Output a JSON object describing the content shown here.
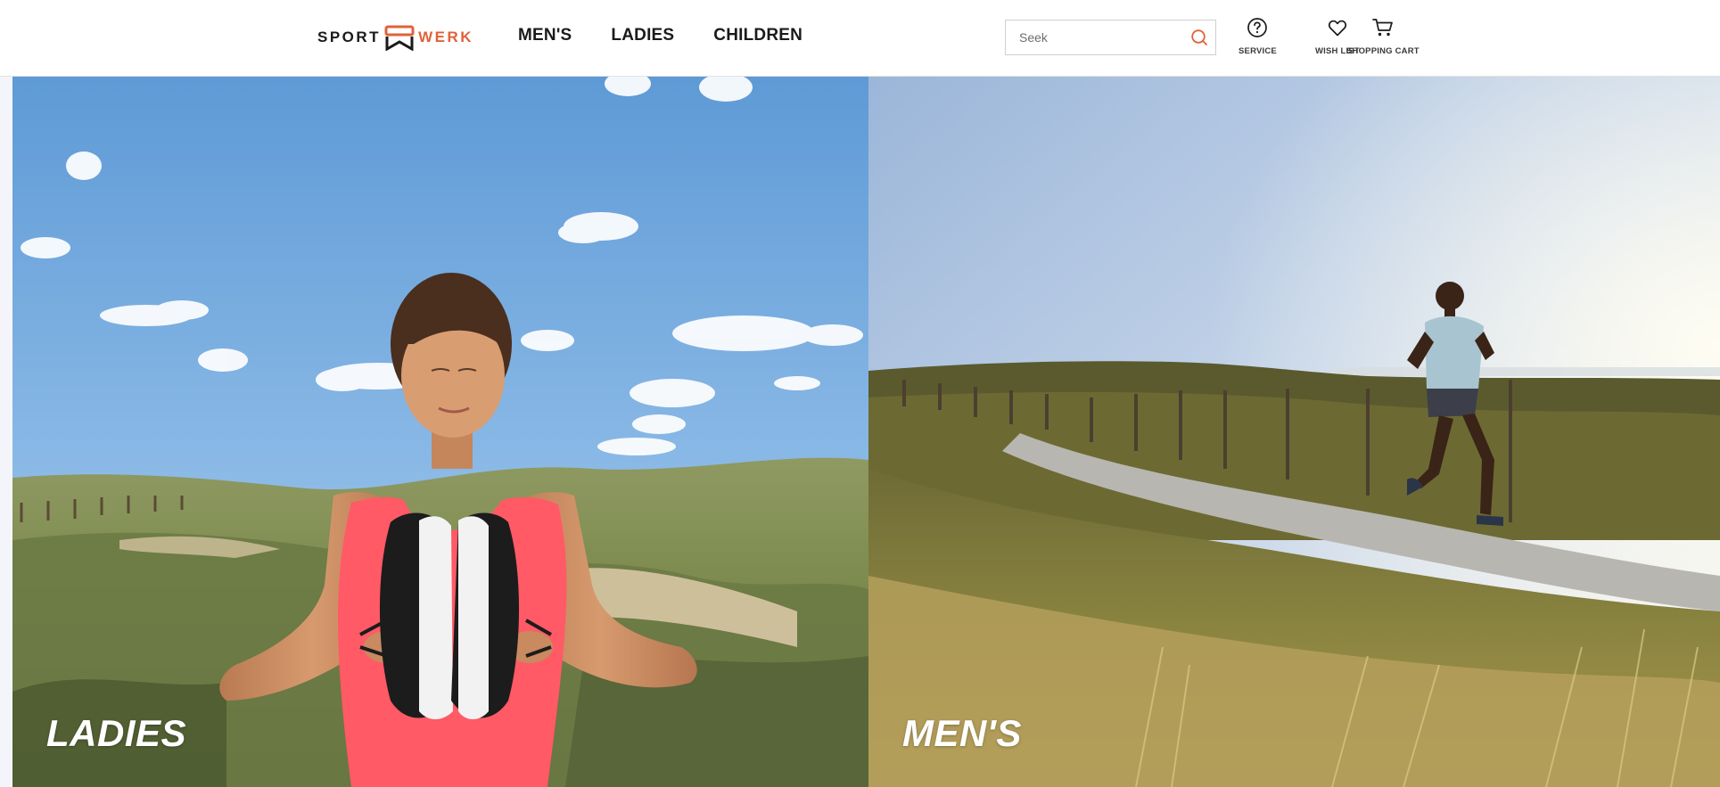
{
  "brand": {
    "name_left": "SPORT",
    "name_right": "WERK",
    "accent_color": "#e0623a"
  },
  "nav": {
    "items": [
      {
        "label": "MEN'S"
      },
      {
        "label": "LADIES"
      },
      {
        "label": "CHILDREN"
      }
    ]
  },
  "search": {
    "placeholder": "Seek",
    "value": "",
    "icon": "search-icon"
  },
  "utilities": {
    "service": {
      "label": "SERVICE",
      "icon": "help-circle-icon"
    },
    "wishlist": {
      "label": "WISH LIST",
      "icon": "heart-icon"
    },
    "cart": {
      "label": "SHOPPING CART",
      "icon": "shopping-cart-icon"
    }
  },
  "hero": {
    "panels": [
      {
        "label": "LADIES",
        "image": "woman-holding-running-shoes-in-dunes"
      },
      {
        "label": "MEN'S",
        "image": "man-running-on-dune-path-at-sunset"
      }
    ]
  }
}
